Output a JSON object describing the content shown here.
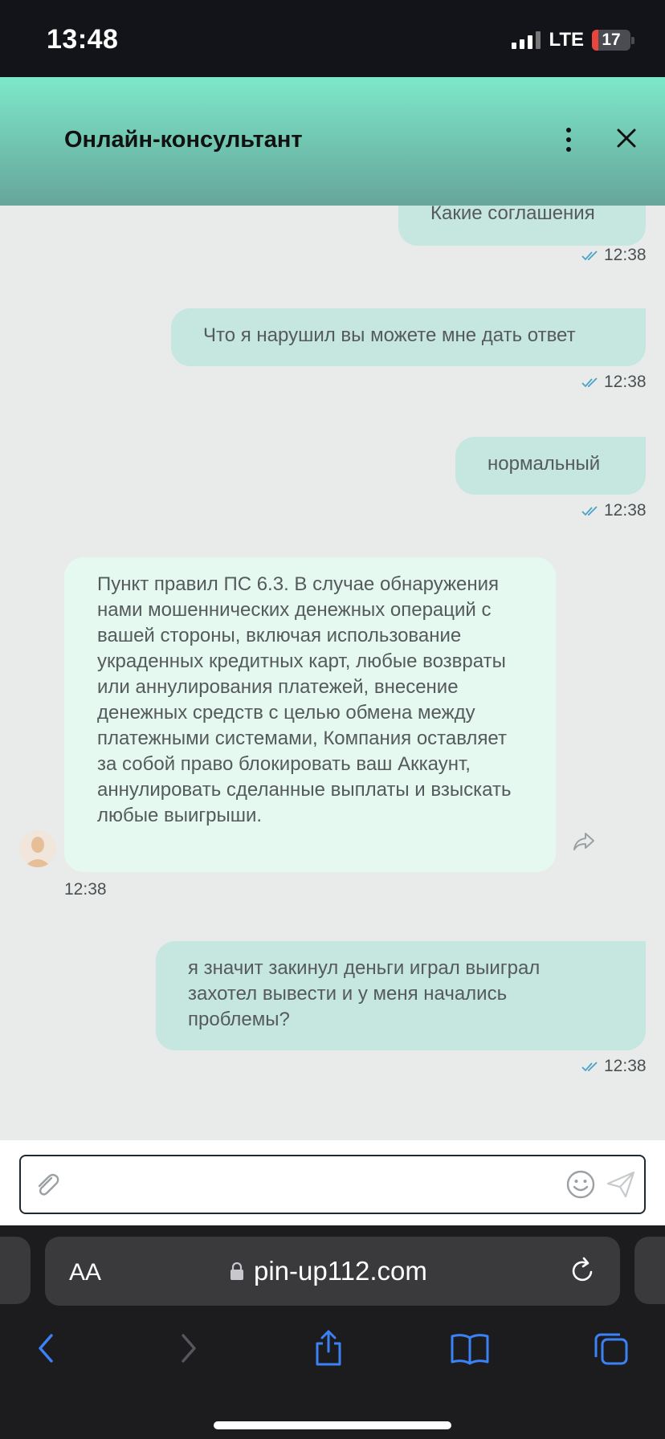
{
  "status_bar": {
    "time": "13:48",
    "network": "LTE",
    "battery": 17
  },
  "header": {
    "title": "Онлайн-консультант"
  },
  "messages": [
    {
      "direction": "out",
      "text": "Какие соглашения",
      "time": "12:38"
    },
    {
      "direction": "out",
      "text": "Что я нарушил вы можете мне дать ответ",
      "time": "12:38"
    },
    {
      "direction": "out",
      "text": "нормальный",
      "time": "12:38"
    },
    {
      "direction": "in",
      "text": "Пункт правил ПС 6.3. В случае обнаружения нами мошеннических денежных операций с вашей стороны, включая использование украденных кредитных карт, любые возвраты или аннулирования платежей, внесение денежных средств с целью обмена между платежными системами, Компания оставляет за собой право блокировать ваш Аккаунт, аннулировать сделанные выплаты и взыскать любые выигрыши.",
      "time": "12:38"
    },
    {
      "direction": "out",
      "text": "я значит закинул деньги играл выиграл захотел вывести и у меня начались проблемы?",
      "time": "12:38"
    }
  ],
  "composer": {
    "placeholder": ""
  },
  "browser": {
    "text_size_label": "AA",
    "url": "pin-up112.com"
  },
  "icons": {
    "more": "more-vertical-icon",
    "close": "close-icon",
    "check": "double-check-icon",
    "share": "share-icon",
    "attach": "paperclip-icon",
    "emoji": "emoji-icon",
    "send": "send-icon",
    "lock": "lock-icon",
    "reload": "reload-icon",
    "back": "back-icon",
    "forward": "forward-icon",
    "share_page": "share-page-icon",
    "bookmarks": "bookmarks-icon",
    "tabs": "tabs-icon"
  },
  "colors": {
    "header_top": "#7de8c9",
    "header_bottom": "#66a59b",
    "outgoing_bubble": "#c6e6e0",
    "incoming_bubble": "#e6f9f0",
    "check": "#4aa3c9"
  }
}
